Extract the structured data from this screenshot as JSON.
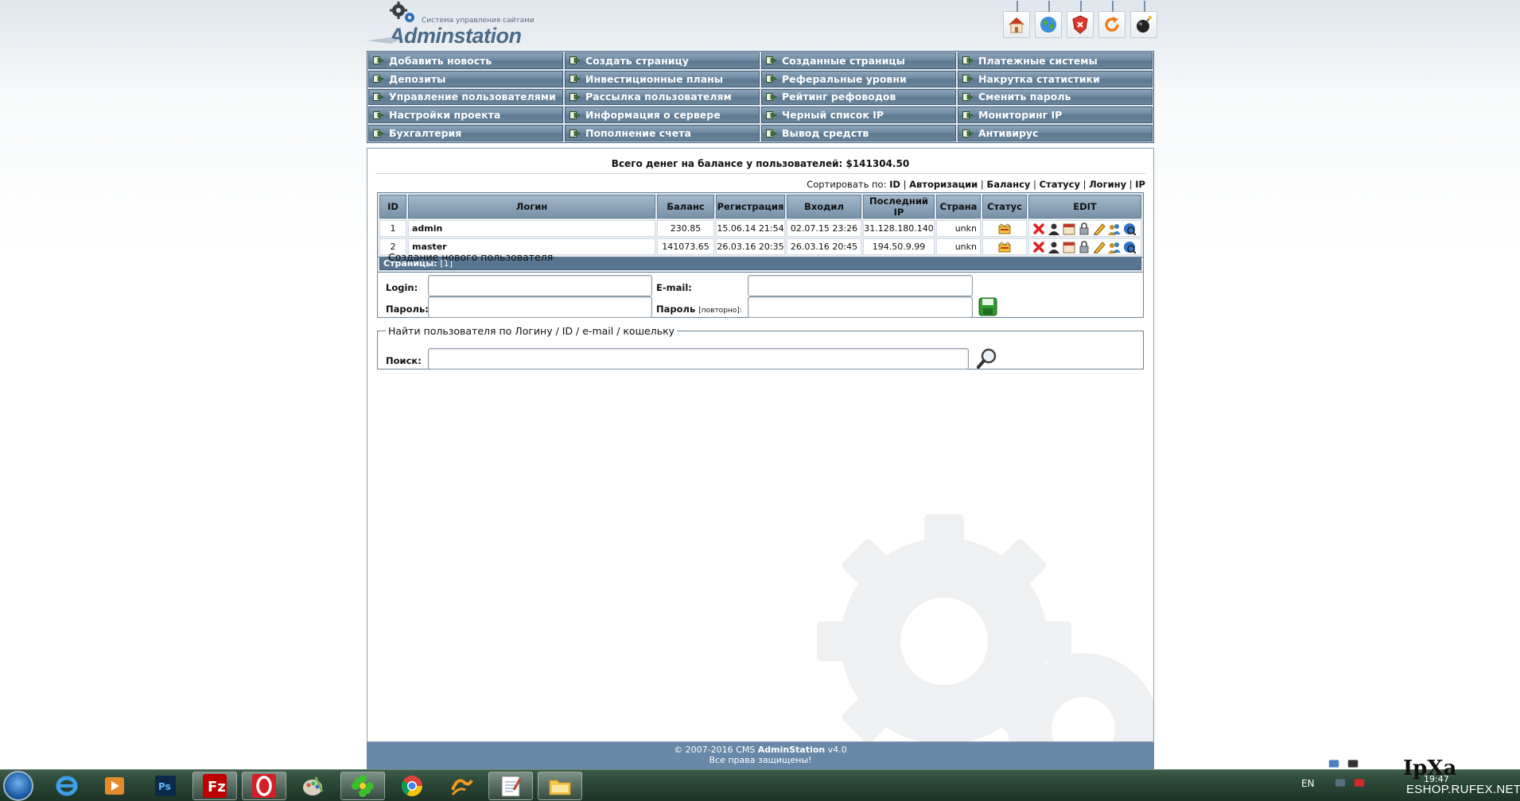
{
  "logo": {
    "slogan": "Система управления сайтами",
    "brand": "Adminstation"
  },
  "top_icons": [
    "home-icon",
    "globe-icon",
    "shield-icon",
    "refresh-icon",
    "bomb-icon"
  ],
  "menu": [
    "Добавить новость",
    "Создать страницу",
    "Созданные страницы",
    "Платежные системы",
    "Депозиты",
    "Инвестиционные планы",
    "Реферальные уровни",
    "Накрутка статистики",
    "Управление пользователями",
    "Рассылка пользователям",
    "Рейтинг рефоводов",
    "Сменить пароль",
    "Настройки проекта",
    "Информация о сервере",
    "Черный список IP",
    "Мониторинг IP",
    "Бухгалтерия",
    "Пополнение счета",
    "Вывод средств",
    "Антивирус"
  ],
  "balance_text": "Всего денег на балансе у пользователей: $141304.50",
  "sort": {
    "label": "Сортировать по:",
    "options": [
      "ID",
      "Авторизации",
      "Балансу",
      "Статусу",
      "Логину",
      "IP"
    ]
  },
  "table": {
    "headers": [
      "ID",
      "Логин",
      "Баланс",
      "Регистрация",
      "Входил",
      "Последний IP",
      "Страна",
      "Статус",
      "EDIT"
    ],
    "rows": [
      {
        "id": "1",
        "login": "admin",
        "balance": "230.85",
        "registered": "15.06.14 21:54",
        "last_login": "02.07.15 23:26",
        "ip": "31.128.180.140",
        "country": "unkn"
      },
      {
        "id": "2",
        "login": "master",
        "balance": "141073.65",
        "registered": "26.03.16 20:35",
        "last_login": "26.03.16 20:45",
        "ip": "194.50.9.99",
        "country": "unkn"
      }
    ],
    "pages_label": "Страницы:",
    "pages_value": "[1]"
  },
  "create_user": {
    "legend": "Создание нового пользователя",
    "login_label": "Login:",
    "email_label": "E-mail:",
    "password_label": "Пароль:",
    "password2_label": "Пароль",
    "password2_hint": "[повторно]:",
    "login_value": "",
    "email_value": "",
    "password_value": "",
    "password2_value": ""
  },
  "search": {
    "legend": "Найти пользователя по Логину / ID / e-mail / кошельку",
    "label": "Поиск:",
    "value": ""
  },
  "footer": {
    "copyright_prefix": "© 2007-2016 CMS",
    "product": "AdminStation",
    "version": "v4.0",
    "rights": "Все права защищены!"
  },
  "taskbar": {
    "apps": [
      "internet-explorer-icon",
      "media-player-icon",
      "photoshop-icon",
      "filezilla-icon",
      "opera-icon",
      "paint-icon",
      "icq-icon",
      "chrome-icon",
      "winamp-icon",
      "notepad-icon",
      "explorer-folder-icon"
    ],
    "lang": "EN",
    "time": "19:47"
  },
  "watermark": {
    "big": "IpXa",
    "small": "ESHOP.RUFEX.NET"
  },
  "colors": {
    "menu_blue": "#6c879f",
    "footer_blue": "#6788a6",
    "pages_bar": "#577590"
  }
}
